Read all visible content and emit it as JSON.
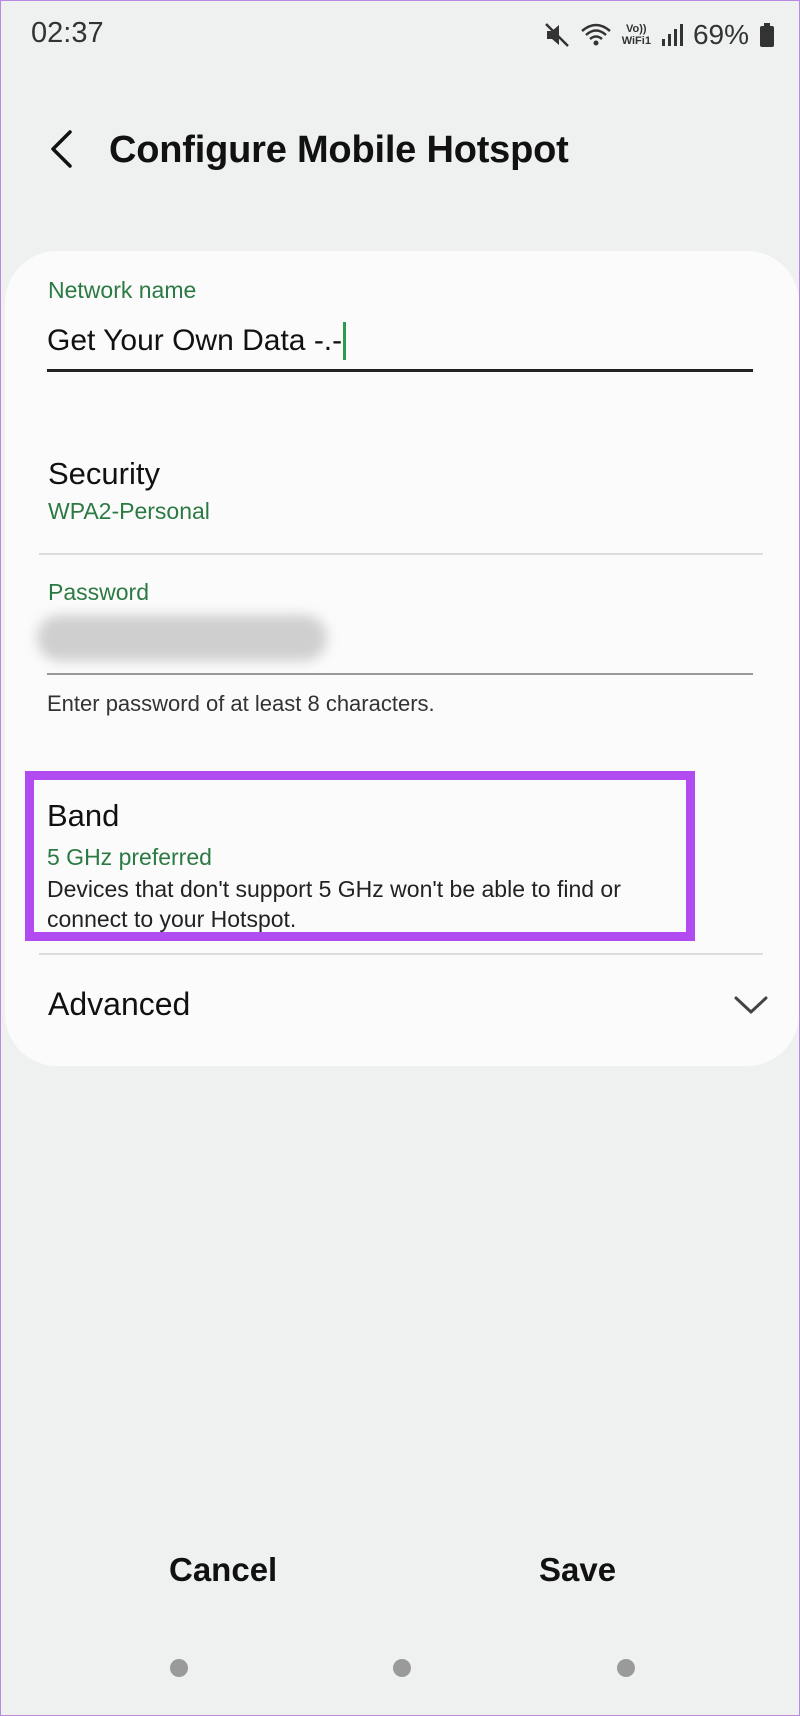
{
  "status_bar": {
    "time": "02:37",
    "battery": "69%",
    "volte_label_top": "Vo))",
    "volte_label_bottom": "WiFi1",
    "icons": [
      "mute-icon",
      "wifi-icon",
      "volte-wifi-icon",
      "signal-icon",
      "battery-icon"
    ]
  },
  "header": {
    "title": "Configure Mobile Hotspot",
    "back_icon": "chevron-left-icon"
  },
  "network_name": {
    "label": "Network name",
    "value": "Get Your Own Data -.-"
  },
  "security": {
    "title": "Security",
    "value": "WPA2-Personal"
  },
  "password": {
    "label": "Password",
    "helper": "Enter password of at least 8 characters."
  },
  "band": {
    "title": "Band",
    "value": "5 GHz preferred",
    "description": "Devices that don't support 5 GHz won't be able to find or connect to your Hotspot."
  },
  "advanced": {
    "label": "Advanced",
    "icon": "chevron-down-icon"
  },
  "actions": {
    "cancel": "Cancel",
    "save": "Save"
  },
  "colors": {
    "accent_green": "#2c7a43",
    "highlight_purple": "#b14cf0",
    "background": "#eff1f0",
    "card": "#fbfbfb"
  }
}
